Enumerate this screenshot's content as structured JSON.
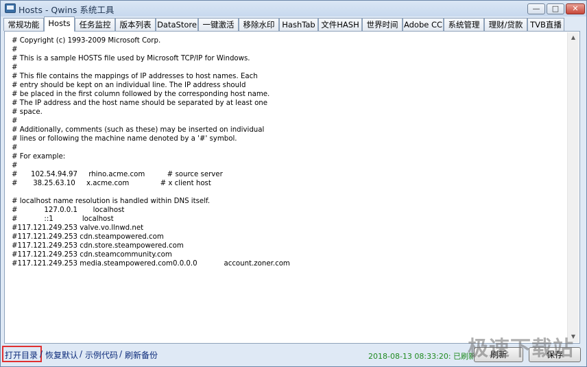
{
  "window": {
    "title": "Hosts - Qwins 系统工具",
    "controls": {
      "minimize": "—",
      "maximize": "□",
      "close": "✕"
    }
  },
  "tabs": [
    {
      "label": "常规功能"
    },
    {
      "label": "Hosts",
      "active": true
    },
    {
      "label": "任务监控"
    },
    {
      "label": "版本列表"
    },
    {
      "label": "DataStore"
    },
    {
      "label": "一键激活"
    },
    {
      "label": "移除水印"
    },
    {
      "label": "HashTab"
    },
    {
      "label": "文件HASH"
    },
    {
      "label": "世界时间"
    },
    {
      "label": "Adobe CC"
    },
    {
      "label": "系统管理"
    },
    {
      "label": "理财/贷款"
    },
    {
      "label": "TVB直播"
    }
  ],
  "hosts_lines": [
    "# Copyright (c) 1993-2009 Microsoft Corp.",
    "#",
    "# This is a sample HOSTS file used by Microsoft TCP/IP for Windows.",
    "#",
    "# This file contains the mappings of IP addresses to host names. Each",
    "# entry should be kept on an individual line. The IP address should",
    "# be placed in the first column followed by the corresponding host name.",
    "# The IP address and the host name should be separated by at least one",
    "# space.",
    "#",
    "# Additionally, comments (such as these) may be inserted on individual",
    "# lines or following the machine name denoted by a '#' symbol.",
    "#",
    "# For example:",
    "#",
    "#      102.54.94.97     rhino.acme.com          # source server",
    "#       38.25.63.10     x.acme.com              # x client host",
    "",
    "# localhost name resolution is handled within DNS itself.",
    "#            127.0.0.1       localhost",
    "#            ::1             localhost",
    "#117.121.249.253 valve.vo.llnwd.net",
    "#117.121.249.253 cdn.steampowered.com",
    "#117.121.249.253 cdn.store.steampowered.com",
    "#117.121.249.253 cdn.steamcommunity.com",
    "#117.121.249.253 media.steampowered.com0.0.0.0            account.zoner.com"
  ],
  "footer": {
    "links": [
      "打开目录",
      "恢复默认",
      "示例代码",
      "刷新备份"
    ],
    "separator": "/",
    "status": "2018-08-13 08:33:20: 已刷新",
    "refresh_button": "刷新",
    "save_button": "保存"
  },
  "watermark": "极速下载站",
  "colors": {
    "status": "#1f8a1f",
    "link": "#0b2a7a",
    "highlight": "#e03030"
  }
}
